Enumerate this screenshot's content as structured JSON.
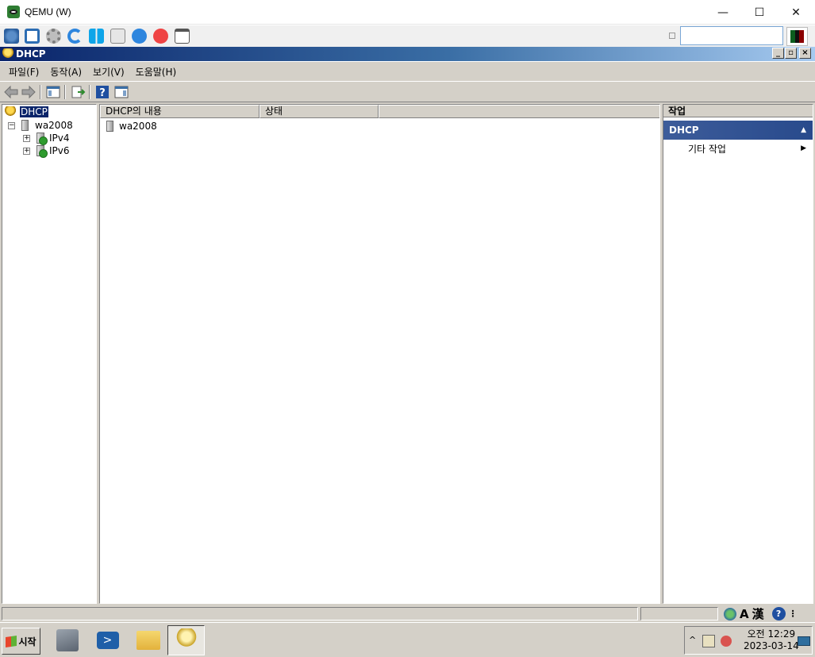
{
  "qemu": {
    "title": "QEMU (W)",
    "minimize": "—",
    "maximize": "☐",
    "close": "✕",
    "toolbar_icons": [
      "settings-cubes-icon",
      "fullscreen-icon",
      "gear-icon",
      "refresh-icon",
      "windows-icon",
      "drive-icon",
      "info-icon",
      "stop-icon",
      "snapshot-icon"
    ],
    "search_value": ""
  },
  "mmc": {
    "title": "DHCP",
    "menu": [
      "파일(F)",
      "동작(A)",
      "보기(V)",
      "도움말(H)"
    ],
    "toolbar_icons": [
      "back-arrow-icon",
      "forward-arrow-icon",
      "show-hide-tree-icon",
      "export-list-icon",
      "help-icon",
      "action-pane-icon"
    ]
  },
  "tree": {
    "root": "DHCP",
    "server": "wa2008",
    "children": [
      "IPv4",
      "IPv6"
    ],
    "expand_minus": "−",
    "expand_plus": "+"
  },
  "list": {
    "columns": [
      "DHCP의 내용",
      "상태"
    ],
    "rows": [
      {
        "name": "wa2008",
        "status": ""
      }
    ]
  },
  "actions": {
    "title": "작업",
    "section": "DHCP",
    "section_arrow": "▲",
    "item": "기타 작업",
    "item_arrow": "▶"
  },
  "statusbar": {
    "ime_a": "A",
    "ime_hanja": "漢",
    "help": "?"
  },
  "taskbar": {
    "start_label": "시작",
    "clock_period": "오전 12:29",
    "clock_date": "2023-03-14",
    "tray_expand": "^"
  }
}
